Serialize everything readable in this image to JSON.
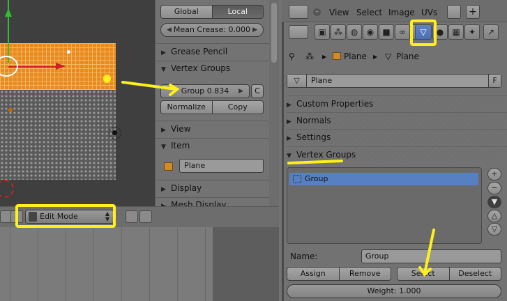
{
  "viewport": {
    "mode_label": "Edit Mode"
  },
  "npanel": {
    "orientation": {
      "global_label": "Global",
      "local_label": "Local",
      "active": "Local"
    },
    "mean_crease": "Mean Crease: 0.000",
    "panels": {
      "grease_pencil": "Grease Pencil",
      "vertex_groups": "Vertex Groups",
      "view": "View",
      "item": "Item",
      "display": "Display",
      "mesh_display": "Mesh Display"
    },
    "vertex_group_weight": "Group 0.834",
    "copy_c": "C",
    "normalize_label": "Normalize",
    "copy_label": "Copy",
    "item_name": "Plane"
  },
  "properties": {
    "menu": {
      "view": "View",
      "select": "Select",
      "image": "Image",
      "uvs": "UVs"
    },
    "breadcrumb": {
      "object": "Plane",
      "data": "Plane"
    },
    "data_name": "Plane",
    "fake_user": "F",
    "panels": {
      "custom_properties": "Custom Properties",
      "normals": "Normals",
      "settings": "Settings",
      "vertex_groups": "Vertex Groups"
    },
    "vertex_groups_list": [
      "Group"
    ],
    "name_label": "Name:",
    "name_value": "Group",
    "buttons": {
      "assign": "Assign",
      "remove": "Remove",
      "select": "Select",
      "deselect": "Deselect"
    },
    "weight": "Weight: 1.000"
  },
  "colors": {
    "selected_mesh": "#e88a20",
    "list_selection": "#5680c2",
    "annotation": "#ffef1a"
  }
}
